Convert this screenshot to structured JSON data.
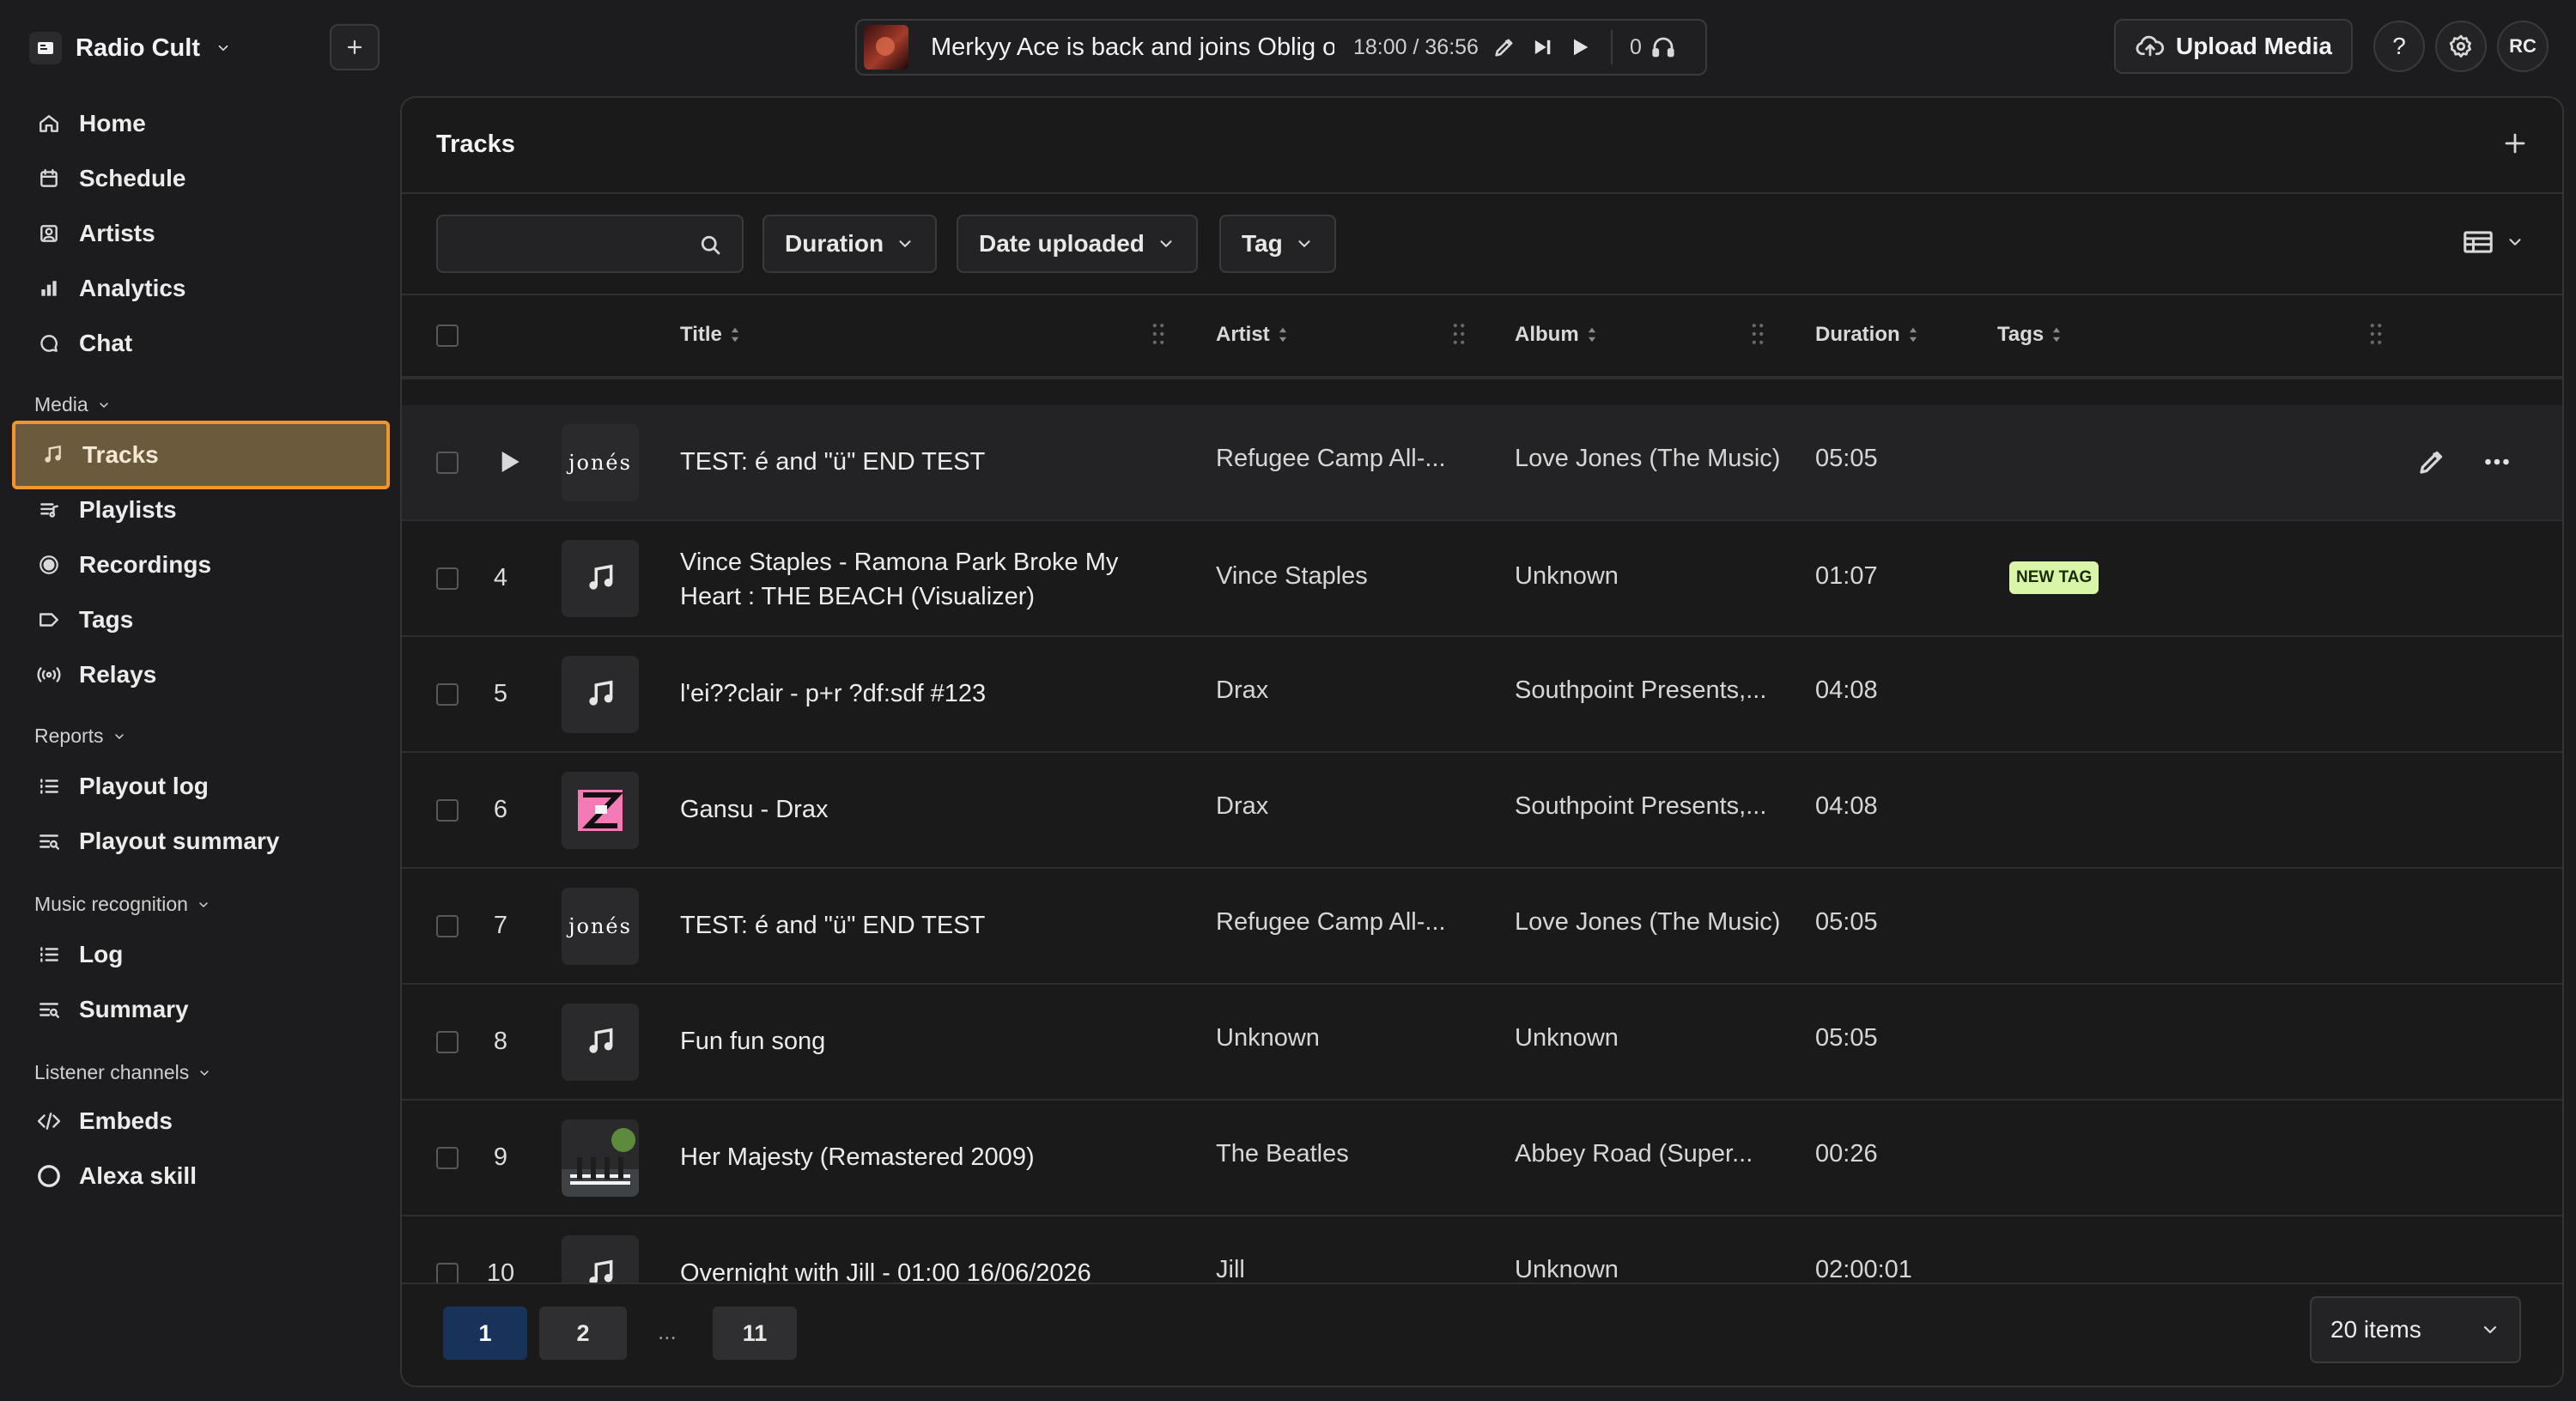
{
  "app": {
    "name": "Radio Cult"
  },
  "player": {
    "now_playing": "Merkyy Ace is back and joins Oblig on",
    "time": "18:00 / 36:56",
    "listeners": "0"
  },
  "header": {
    "upload_label": "Upload Media",
    "help_label": "?",
    "avatar_initials": "RC"
  },
  "sidebar": {
    "main_items": [
      {
        "label": "Home",
        "icon": "home-icon"
      },
      {
        "label": "Schedule",
        "icon": "calendar-icon"
      },
      {
        "label": "Artists",
        "icon": "artist-icon"
      },
      {
        "label": "Analytics",
        "icon": "bar-chart-icon"
      },
      {
        "label": "Chat",
        "icon": "chat-icon"
      }
    ],
    "media_label": "Media",
    "media_items": [
      {
        "label": "Tracks",
        "icon": "music-note-icon",
        "active": true
      },
      {
        "label": "Playlists",
        "icon": "playlist-icon"
      },
      {
        "label": "Recordings",
        "icon": "record-icon"
      },
      {
        "label": "Tags",
        "icon": "tag-icon"
      },
      {
        "label": "Relays",
        "icon": "broadcast-icon"
      }
    ],
    "reports_label": "Reports",
    "reports_items": [
      {
        "label": "Playout log",
        "icon": "list-icon"
      },
      {
        "label": "Playout summary",
        "icon": "summary-icon"
      }
    ],
    "music_label": "Music recognition",
    "music_items": [
      {
        "label": "Log",
        "icon": "list-icon"
      },
      {
        "label": "Summary",
        "icon": "summary-icon"
      }
    ],
    "listener_label": "Listener channels",
    "listener_items": [
      {
        "label": "Embeds",
        "icon": "code-icon"
      },
      {
        "label": "Alexa skill",
        "icon": "alexa-icon"
      }
    ]
  },
  "tracks": {
    "title": "Tracks",
    "search_placeholder": "",
    "filters": [
      "Duration",
      "Date uploaded",
      "Tag"
    ],
    "columns": {
      "title": "Title",
      "artist": "Artist",
      "album": "Album",
      "duration": "Duration",
      "tags": "Tags"
    },
    "rows": [
      {
        "num": "",
        "title": "TEST: é and \"ü\" END TEST",
        "artist": "Refugee Camp All-...",
        "album": "Love Jones (The Music)",
        "duration": "05:05",
        "tag": "",
        "art": "jones",
        "hover": true
      },
      {
        "num": "4",
        "title": "Vince Staples - Ramona Park Broke My Heart : THE BEACH (Visualizer)",
        "artist": "Vince Staples",
        "album": "Unknown",
        "duration": "01:07",
        "tag": "NEW TAG",
        "art": "note"
      },
      {
        "num": "5",
        "title": "l'ei??clair - p+r ?df:sdf #123",
        "artist": "Drax",
        "album": "Southpoint Presents,...",
        "duration": "04:08",
        "tag": "",
        "art": "note"
      },
      {
        "num": "6",
        "title": "Gansu - Drax",
        "artist": "Drax",
        "album": "Southpoint Presents,...",
        "duration": "04:08",
        "tag": "",
        "art": "gansu"
      },
      {
        "num": "7",
        "title": "TEST: é and \"ü\" END TEST",
        "artist": "Refugee Camp All-...",
        "album": "Love Jones (The Music)",
        "duration": "05:05",
        "tag": "",
        "art": "jones"
      },
      {
        "num": "8",
        "title": "Fun fun song",
        "artist": "Unknown",
        "album": "Unknown",
        "duration": "05:05",
        "tag": "",
        "art": "note"
      },
      {
        "num": "9",
        "title": "Her Majesty (Remastered 2009)",
        "artist": "The Beatles",
        "album": "Abbey Road (Super...",
        "duration": "00:26",
        "tag": "",
        "art": "beatles"
      },
      {
        "num": "10",
        "title": "Overnight with Jill - 01:00 16/06/2026",
        "artist": "Jill",
        "album": "Unknown",
        "duration": "02:00:01",
        "tag": "",
        "art": "note"
      }
    ],
    "art_text": {
      "jones": "jonés"
    }
  },
  "pagination": {
    "pages": [
      "1",
      "2",
      "11"
    ],
    "current": "1",
    "ellipsis": "...",
    "page_size": "20 items"
  },
  "colors": {
    "accent_outline": "#f0962d",
    "active_bg": "#6b5a3c",
    "tag_bg": "#d9f5a8",
    "page_active": "#18325a"
  }
}
